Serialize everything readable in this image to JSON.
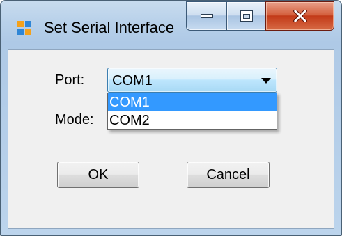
{
  "window": {
    "title": "Set Serial Interface"
  },
  "caption_buttons": {
    "minimize_icon": "minimize-icon",
    "maximize_icon": "maximize-icon",
    "close_icon": "close-icon"
  },
  "form": {
    "port_label": "Port:",
    "mode_label": "Mode:",
    "port_value": "COM1",
    "port_options": [
      "COM1",
      "COM2"
    ],
    "port_selected_option": "COM1"
  },
  "buttons": {
    "ok": "OK",
    "cancel": "Cancel"
  },
  "colors": {
    "highlight": "#3399ff",
    "close_button": "#c23a18",
    "combo_border": "#3c7fb1"
  }
}
